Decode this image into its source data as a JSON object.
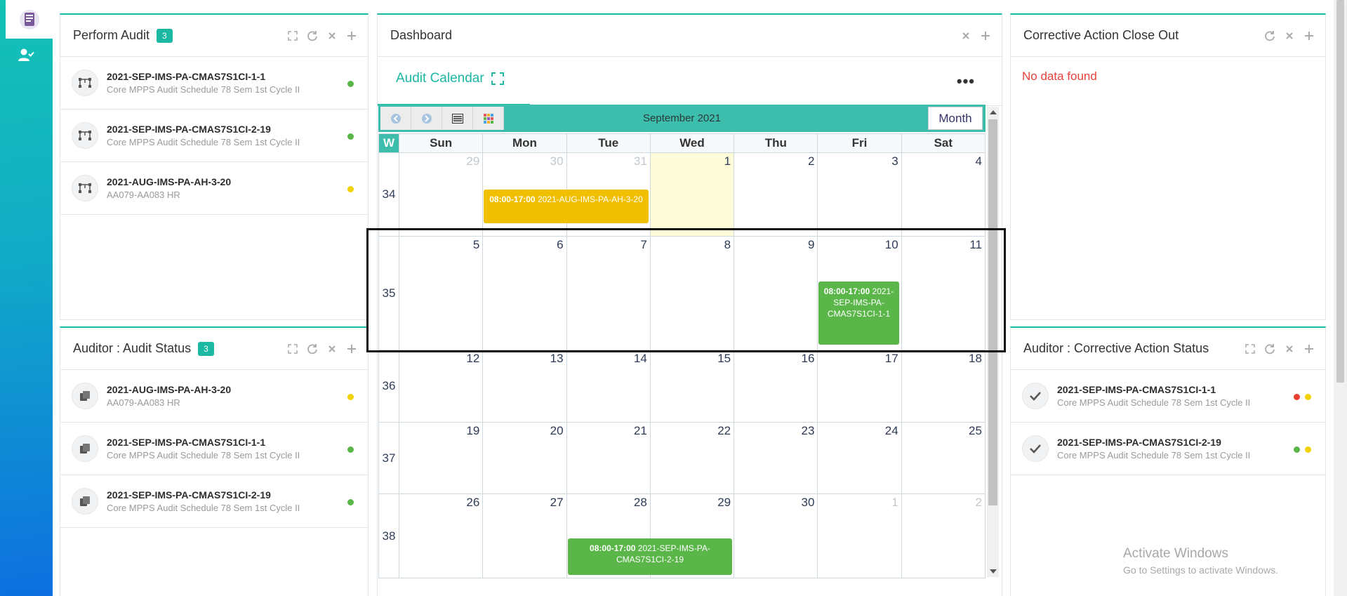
{
  "panels": {
    "perform_audit": {
      "title": "Perform Audit",
      "badge": "3",
      "items": [
        {
          "title": "2021-SEP-IMS-PA-CMAS7S1CI-1-1",
          "sub": "Core MPPS Audit Schedule 78 Sem 1st Cycle II",
          "status_color": "#5bb64a"
        },
        {
          "title": "2021-SEP-IMS-PA-CMAS7S1CI-2-19",
          "sub": "Core MPPS Audit Schedule 78 Sem 1st Cycle II",
          "status_color": "#5bb64a"
        },
        {
          "title": "2021-AUG-IMS-PA-AH-3-20",
          "sub": "AA079-AA083 HR",
          "status_color": "#f2d100"
        }
      ]
    },
    "auditor_status": {
      "title": "Auditor : Audit Status",
      "badge": "3",
      "items": [
        {
          "title": "2021-AUG-IMS-PA-AH-3-20",
          "sub": "AA079-AA083 HR",
          "status_color": "#f2d100"
        },
        {
          "title": "2021-SEP-IMS-PA-CMAS7S1CI-1-1",
          "sub": "Core MPPS Audit Schedule 78 Sem 1st Cycle II",
          "status_color": "#5bb64a"
        },
        {
          "title": "2021-SEP-IMS-PA-CMAS7S1CI-2-19",
          "sub": "Core MPPS Audit Schedule 78 Sem 1st Cycle II",
          "status_color": "#5bb64a"
        }
      ]
    },
    "dashboard": {
      "title": "Dashboard",
      "tab_label": "Audit Calendar",
      "more_label": "•••"
    },
    "ca_closeout": {
      "title": "Corrective Action Close Out",
      "empty_text": "No data found"
    },
    "auditor_ca_status": {
      "title": "Auditor : Corrective Action Status",
      "items": [
        {
          "title": "2021-SEP-IMS-PA-CMAS7S1CI-1-1",
          "sub": "Core MPPS Audit Schedule 78 Sem 1st Cycle II",
          "dot_colors": [
            "#e8402e",
            "#f2d100"
          ]
        },
        {
          "title": "2021-SEP-IMS-PA-CMAS7S1CI-2-19",
          "sub": "Core MPPS Audit Schedule 78 Sem 1st Cycle II",
          "dot_colors": [
            "#5bb64a",
            "#f2d100"
          ]
        }
      ]
    }
  },
  "calendar": {
    "month_title": "September 2021",
    "view_label": "Month",
    "week_header": "W",
    "day_headers": [
      "Sun",
      "Mon",
      "Tue",
      "Wed",
      "Thu",
      "Fri",
      "Sat"
    ],
    "weeks": [
      {
        "week": "34",
        "days": [
          {
            "n": "29",
            "other": true
          },
          {
            "n": "30",
            "other": true
          },
          {
            "n": "31",
            "other": true
          },
          {
            "n": "1",
            "today": true
          },
          {
            "n": "2"
          },
          {
            "n": "3"
          },
          {
            "n": "4"
          }
        ]
      },
      {
        "week": "35",
        "days": [
          {
            "n": "5"
          },
          {
            "n": "6"
          },
          {
            "n": "7"
          },
          {
            "n": "8"
          },
          {
            "n": "9"
          },
          {
            "n": "10"
          },
          {
            "n": "11"
          }
        ]
      },
      {
        "week": "36",
        "days": [
          {
            "n": "12"
          },
          {
            "n": "13"
          },
          {
            "n": "14"
          },
          {
            "n": "15"
          },
          {
            "n": "16"
          },
          {
            "n": "17"
          },
          {
            "n": "18"
          }
        ]
      },
      {
        "week": "37",
        "days": [
          {
            "n": "19"
          },
          {
            "n": "20"
          },
          {
            "n": "21"
          },
          {
            "n": "22"
          },
          {
            "n": "23"
          },
          {
            "n": "24"
          },
          {
            "n": "25"
          }
        ]
      },
      {
        "week": "38",
        "days": [
          {
            "n": "26"
          },
          {
            "n": "27"
          },
          {
            "n": "28"
          },
          {
            "n": "29"
          },
          {
            "n": "30"
          },
          {
            "n": "1",
            "other": true
          },
          {
            "n": "2",
            "other": true
          }
        ]
      }
    ],
    "events": [
      {
        "time": "08:00-17:00",
        "title": "2021-AUG-IMS-PA-AH-3-20",
        "color": "yellow"
      },
      {
        "time": "08:00-17:00",
        "title": "2021-SEP-IMS-PA-CMAS7S1CI-1-1",
        "color": "green"
      },
      {
        "time": "08:00-17:00",
        "title": "2021-SEP-IMS-PA-CMAS7S1CI-2-19",
        "color": "green"
      }
    ]
  },
  "watermark": {
    "line1": "Activate Windows",
    "line2": "Go to Settings to activate Windows."
  }
}
